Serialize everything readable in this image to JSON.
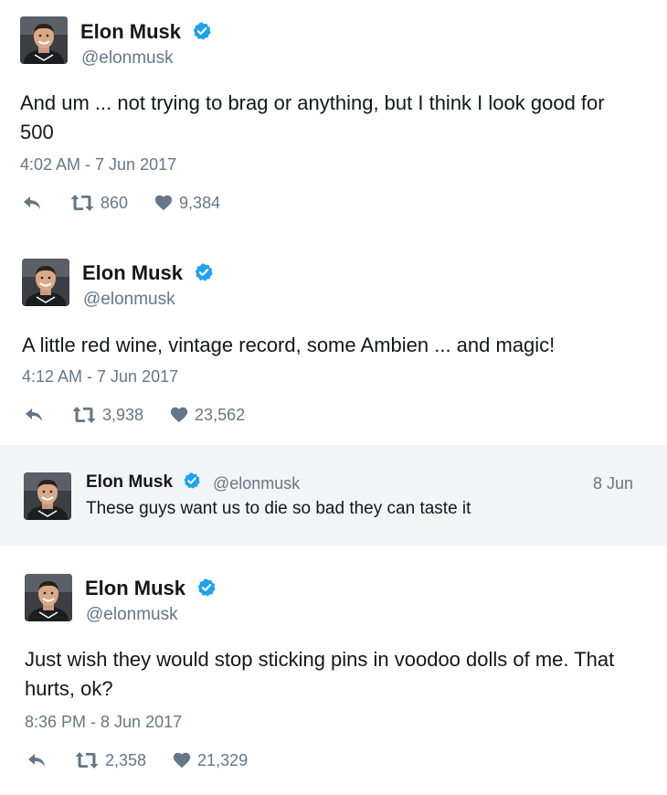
{
  "tweets": [
    {
      "name": "Elon Musk",
      "handle": "@elonmusk",
      "text": "And um ... not trying to brag or anything, but I think I look good for 500",
      "time": "4:02 AM - 7 Jun 2017",
      "retweets": "860",
      "likes": "9,384"
    },
    {
      "name": "Elon Musk",
      "handle": "@elonmusk",
      "text": "A little red wine, vintage record, some Ambien ... and magic!",
      "time": "4:12 AM - 7 Jun 2017",
      "retweets": "3,938",
      "likes": "23,562"
    },
    {
      "name": "Elon Musk",
      "handle": "@elonmusk",
      "text": "Just wish they would stop sticking pins in voodoo dolls of me. That hurts, ok?",
      "time": "8:36 PM - 8 Jun 2017",
      "retweets": "2,358",
      "likes": "21,329"
    }
  ],
  "quoted": {
    "name": "Elon Musk",
    "handle": "@elonmusk",
    "date": "8 Jun",
    "text": "These guys want us to die so bad they can taste it"
  },
  "icons": {
    "verified": "verified-badge-icon",
    "reply": "reply-icon",
    "retweet": "retweet-icon",
    "like": "heart-icon"
  },
  "colors": {
    "verified": "#1da1f2",
    "text": "#14171a",
    "muted": "#657786",
    "quoted_bg": "#f2f4f6"
  }
}
